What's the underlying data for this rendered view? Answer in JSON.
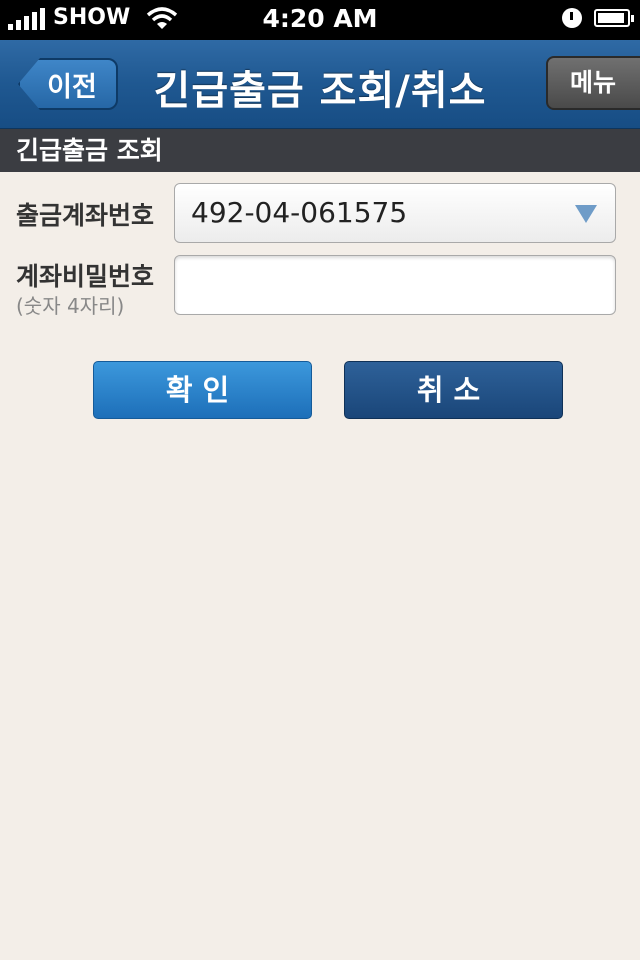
{
  "status_bar": {
    "carrier": "SHOW",
    "time": "4:20 AM"
  },
  "nav": {
    "back_label": "이전",
    "title": "긴급출금 조회/취소",
    "menu_label": "메뉴"
  },
  "section": {
    "title": "긴급출금 조회"
  },
  "form": {
    "account_label": "출금계좌번호",
    "account_value": "492-04-061575",
    "password_label": "계좌비밀번호",
    "password_hint": "(숫자 4자리)",
    "password_value": ""
  },
  "buttons": {
    "confirm": "확인",
    "cancel": "취소"
  },
  "colors": {
    "nav_background": "#1f5891",
    "page_background": "#f3eee8",
    "confirm_button": "#2a83cb",
    "cancel_button": "#235489"
  }
}
